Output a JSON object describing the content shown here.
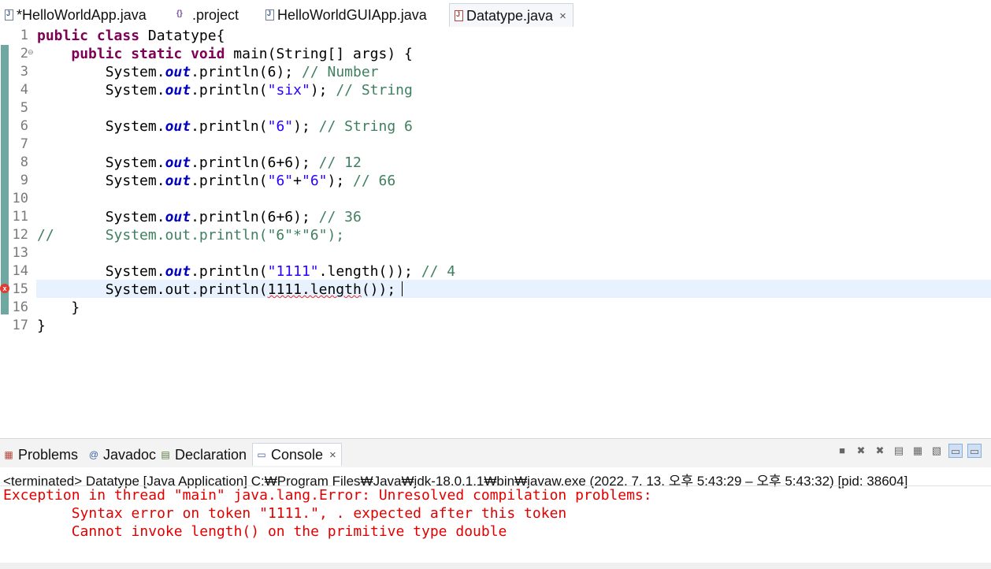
{
  "tabs": [
    {
      "label": "*HelloWorldApp.java",
      "icon": "java-file-icon"
    },
    {
      "label": ".project",
      "icon": "project-file-icon"
    },
    {
      "label": "HelloWorldGUIApp.java",
      "icon": "java-file-icon"
    },
    {
      "label": "Datatype.java",
      "icon": "java-file-error-icon",
      "active": true,
      "close": "×"
    }
  ],
  "editor": {
    "line_numbers": [
      "1",
      "2",
      "3",
      "4",
      "5",
      "6",
      "7",
      "8",
      "9",
      "10",
      "11",
      "12",
      "13",
      "14",
      "15",
      "16",
      "17"
    ],
    "lines": [
      [
        {
          "t": "kw",
          "v": "public class"
        },
        {
          "t": "",
          "v": " Datatype{"
        }
      ],
      [
        {
          "t": "",
          "v": "    "
        },
        {
          "t": "kw",
          "v": "public static void"
        },
        {
          "t": "",
          "v": " main(String[] args) {"
        }
      ],
      [
        {
          "t": "",
          "v": "        System."
        },
        {
          "t": "fld",
          "v": "out"
        },
        {
          "t": "",
          "v": ".println(6); "
        },
        {
          "t": "cmt",
          "v": "// Number"
        }
      ],
      [
        {
          "t": "",
          "v": "        System."
        },
        {
          "t": "fld",
          "v": "out"
        },
        {
          "t": "",
          "v": ".println("
        },
        {
          "t": "str",
          "v": "\"six\""
        },
        {
          "t": "",
          "v": "); "
        },
        {
          "t": "cmt",
          "v": "// String"
        }
      ],
      [],
      [
        {
          "t": "",
          "v": "        System."
        },
        {
          "t": "fld",
          "v": "out"
        },
        {
          "t": "",
          "v": ".println("
        },
        {
          "t": "str",
          "v": "\"6\""
        },
        {
          "t": "",
          "v": "); "
        },
        {
          "t": "cmt",
          "v": "// String 6"
        }
      ],
      [],
      [
        {
          "t": "",
          "v": "        System."
        },
        {
          "t": "fld",
          "v": "out"
        },
        {
          "t": "",
          "v": ".println(6+6); "
        },
        {
          "t": "cmt",
          "v": "// 12"
        }
      ],
      [
        {
          "t": "",
          "v": "        System."
        },
        {
          "t": "fld",
          "v": "out"
        },
        {
          "t": "",
          "v": ".println("
        },
        {
          "t": "str",
          "v": "\"6\""
        },
        {
          "t": "",
          "v": "+"
        },
        {
          "t": "str",
          "v": "\"6\""
        },
        {
          "t": "",
          "v": "); "
        },
        {
          "t": "cmt",
          "v": "// 66"
        }
      ],
      [],
      [
        {
          "t": "",
          "v": "        System."
        },
        {
          "t": "fld",
          "v": "out"
        },
        {
          "t": "",
          "v": ".println(6+6); "
        },
        {
          "t": "cmt",
          "v": "// 36"
        }
      ],
      [
        {
          "t": "cmt",
          "v": "//      System.out.println(\"6\"*\"6\");"
        }
      ],
      [],
      [
        {
          "t": "",
          "v": "        System."
        },
        {
          "t": "fld",
          "v": "out"
        },
        {
          "t": "",
          "v": ".println("
        },
        {
          "t": "str",
          "v": "\"1111\""
        },
        {
          "t": "",
          "v": ".length()); "
        },
        {
          "t": "cmt",
          "v": "// 4"
        }
      ],
      [
        {
          "t": "",
          "v": "        System.out.println("
        },
        {
          "t": "squig",
          "v": "1111.length"
        },
        {
          "t": "",
          "v": "());"
        }
      ],
      [
        {
          "t": "",
          "v": "    }"
        }
      ],
      [
        {
          "t": "",
          "v": "}"
        }
      ]
    ]
  },
  "panel": {
    "tabs": [
      {
        "label": "Problems",
        "icon": "problems-icon"
      },
      {
        "label": "Javadoc",
        "icon": "javadoc-icon"
      },
      {
        "label": "Declaration",
        "icon": "declaration-icon"
      },
      {
        "label": "Console",
        "icon": "console-icon",
        "active": true,
        "close": "×"
      }
    ],
    "toolbar_icons": [
      "terminate-icon",
      "remove-launch-icon",
      "remove-all-icon",
      "scroll-lock-icon",
      "word-wrap-icon",
      "pin-console-icon",
      "display-console-icon",
      "open-console-icon"
    ]
  },
  "console": {
    "terminated": "<terminated> Datatype [Java Application] C:₩Program Files₩Java₩jdk-18.0.1.1₩bin₩javaw.exe  (2022. 7. 13. 오후 5:43:29 – 오후 5:43:32) [pid: 38604]",
    "lines": [
      "Exception in thread \"main\" java.lang.Error: Unresolved compilation problems: ",
      "        Syntax error on token \"1111.\", . expected after this token",
      "        Cannot invoke length() on the primitive type double"
    ]
  },
  "colors": {
    "keyword": "#7f0055",
    "field": "#0000c0",
    "string": "#2a00ff",
    "comment": "#3f7f5f",
    "error": "#e00000"
  }
}
